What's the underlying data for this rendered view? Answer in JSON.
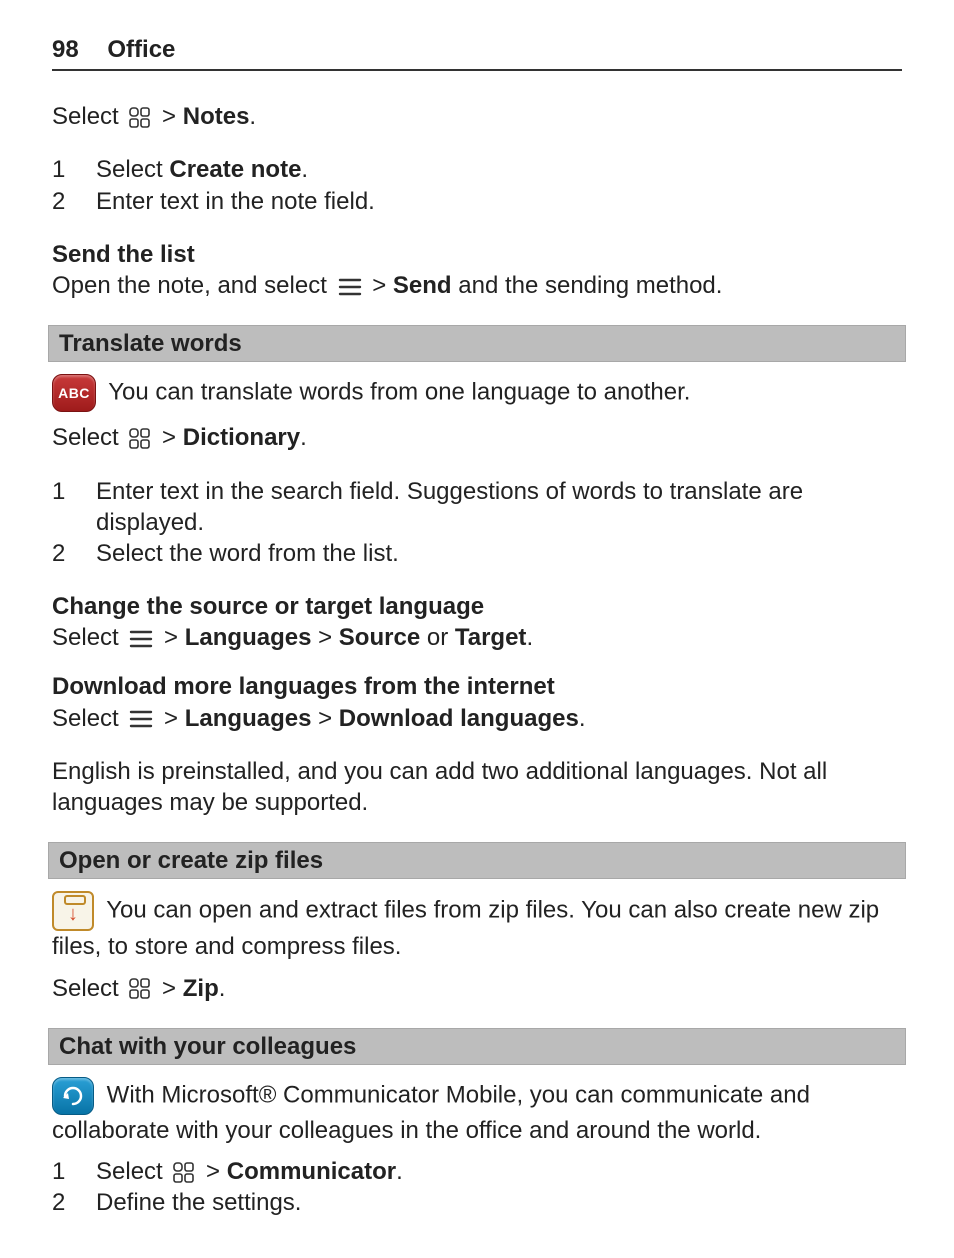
{
  "header": {
    "page_number": "98",
    "title": "Office"
  },
  "notes": {
    "select_prefix": "Select ",
    "gt": " > ",
    "notes_label": "Notes",
    "period": ".",
    "steps": [
      {
        "n": "1",
        "pre": "Select ",
        "bold": "Create note",
        "post": "."
      },
      {
        "n": "2",
        "pre": "Enter text in the note field.",
        "bold": "",
        "post": ""
      }
    ],
    "send_head": "Send the list",
    "send_line_pre": "Open the note, and select ",
    "send_gt": " > ",
    "send_bold": "Send",
    "send_post": " and the sending method."
  },
  "translate": {
    "bar": "Translate words",
    "intro": " You can translate words from one language to another.",
    "select_prefix": "Select ",
    "gt": " > ",
    "dict_label": "Dictionary",
    "period": ".",
    "steps": [
      {
        "n": "1",
        "t": "Enter text in the search field. Suggestions of words to translate are displayed."
      },
      {
        "n": "2",
        "t": "Select the word from the list."
      }
    ],
    "change_head": "Change the source or target language",
    "change_pre": "Select ",
    "change_gt1": " > ",
    "change_lang": "Languages",
    "change_gt2": "  > ",
    "change_source": "Source",
    "change_or": " or ",
    "change_target": "Target",
    "download_head": "Download more languages from the internet",
    "dl_pre": "Select ",
    "dl_gt1": " > ",
    "dl_lang": "Languages",
    "dl_gt2": "  > ",
    "dl_dl": "Download languages",
    "note": "English is preinstalled, and you can add two additional languages. Not all languages may be supported."
  },
  "zip": {
    "bar": "Open or create zip files",
    "intro": " You can open and extract files from zip files. You can also create new zip files, to store and compress files.",
    "select_prefix": "Select ",
    "gt": " > ",
    "zip_label": "Zip",
    "period": "."
  },
  "chat": {
    "bar": "Chat with your colleagues",
    "intro": " With Microsoft® Communicator Mobile, you can communicate and collaborate with your colleagues in the office and around the world.",
    "steps": [
      {
        "n": "1",
        "pre": "Select ",
        "gt": " > ",
        "bold": "Communicator",
        "post": "."
      },
      {
        "n": "2",
        "pre": "Define the settings.",
        "gt": "",
        "bold": "",
        "post": ""
      }
    ]
  },
  "icons": {
    "abc_label": "ABC",
    "zip_glyph": "↓"
  }
}
